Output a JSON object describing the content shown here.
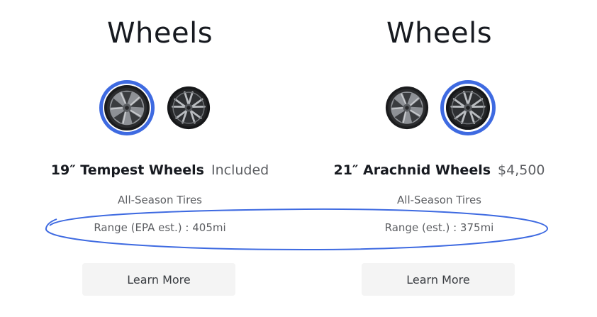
{
  "colors": {
    "accent": "#3e6ae1",
    "text_primary": "#171a20",
    "text_secondary": "#5c5e62",
    "button_bg": "#f4f4f4",
    "annotation": "#3e6ae1"
  },
  "left": {
    "title": "Wheels",
    "options": [
      {
        "icon": "tempest-wheel-icon",
        "selected": true
      },
      {
        "icon": "arachnid-wheel-icon",
        "selected": false
      }
    ],
    "wheel_name": "19″ Tempest Wheels",
    "price": "Included",
    "tires": "All-Season Tires",
    "range": "Range (EPA est.) : 405mi",
    "learn_more": "Learn More"
  },
  "right": {
    "title": "Wheels",
    "options": [
      {
        "icon": "tempest-wheel-icon",
        "selected": false
      },
      {
        "icon": "arachnid-wheel-icon",
        "selected": true
      }
    ],
    "wheel_name": "21″ Arachnid Wheels",
    "price": "$4,500",
    "tires": "All-Season Tires",
    "range": "Range (est.) : 375mi",
    "learn_more": "Learn More"
  }
}
